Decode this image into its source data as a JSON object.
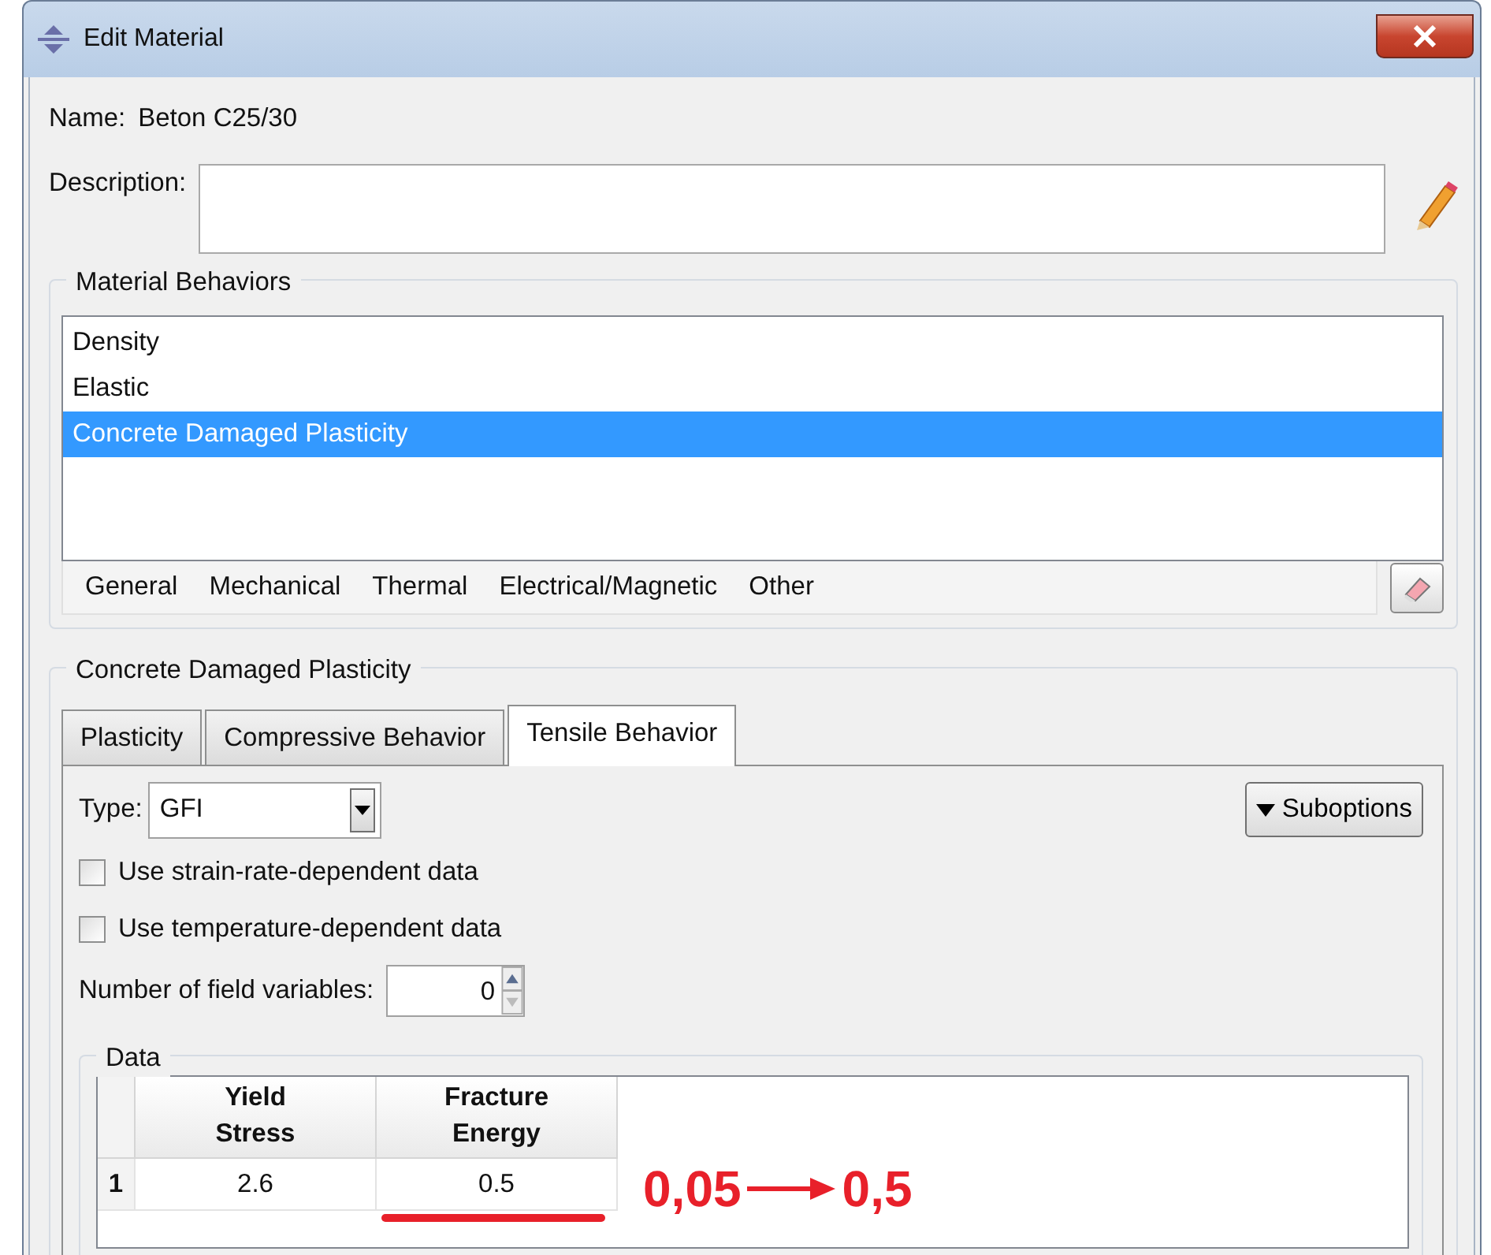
{
  "window": {
    "title": "Edit Material"
  },
  "name": {
    "label": "Name:",
    "value": "Beton C25/30"
  },
  "description": {
    "label": "Description:"
  },
  "material_behaviors": {
    "title": "Material Behaviors",
    "items": [
      {
        "label": "Density",
        "selected": false
      },
      {
        "label": "Elastic",
        "selected": false
      },
      {
        "label": "Concrete Damaged Plasticity",
        "selected": true
      }
    ],
    "menu": [
      "General",
      "Mechanical",
      "Thermal",
      "Electrical/Magnetic",
      "Other"
    ]
  },
  "section": {
    "title": "Concrete Damaged Plasticity",
    "tabs": [
      {
        "label": "Plasticity",
        "selected": false
      },
      {
        "label": "Compressive Behavior",
        "selected": false
      },
      {
        "label": "Tensile Behavior",
        "selected": true
      }
    ],
    "type": {
      "label": "Type:",
      "value": "GFI"
    },
    "suboptions": "Suboptions",
    "checkboxes": [
      {
        "label": "Use strain-rate-dependent data",
        "checked": false
      },
      {
        "label": "Use temperature-dependent data",
        "checked": false
      }
    ],
    "field_variables": {
      "label": "Number of field variables:",
      "value": "0"
    },
    "data": {
      "title": "Data",
      "columns": [
        "Yield Stress",
        "Fracture Energy"
      ],
      "rows": [
        {
          "index": "1",
          "cells": [
            "2.6",
            "0.5"
          ]
        }
      ]
    }
  },
  "annotation": {
    "from": "0,05",
    "to": "0,5"
  }
}
